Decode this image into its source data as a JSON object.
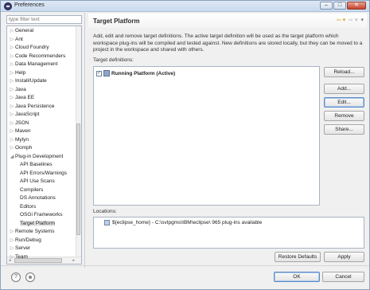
{
  "window": {
    "title": "Preferences",
    "controls": {
      "minimize": "–",
      "maximize": "□",
      "close": "✕"
    }
  },
  "sidebar": {
    "filter_placeholder": "type filter text",
    "items": [
      {
        "label": "General",
        "arrow": "▷",
        "indent": 0
      },
      {
        "label": "Ant",
        "arrow": "▷",
        "indent": 0
      },
      {
        "label": "Cloud Foundry",
        "arrow": "▷",
        "indent": 0
      },
      {
        "label": "Code Recommenders",
        "arrow": "▷",
        "indent": 0
      },
      {
        "label": "Data Management",
        "arrow": "▷",
        "indent": 0
      },
      {
        "label": "Help",
        "arrow": "▷",
        "indent": 0
      },
      {
        "label": "Install/Update",
        "arrow": "▷",
        "indent": 0
      },
      {
        "label": "Java",
        "arrow": "▷",
        "indent": 0
      },
      {
        "label": "Java EE",
        "arrow": "▷",
        "indent": 0
      },
      {
        "label": "Java Persistence",
        "arrow": "▷",
        "indent": 0
      },
      {
        "label": "JavaScript",
        "arrow": "▷",
        "indent": 0
      },
      {
        "label": "JSON",
        "arrow": "▷",
        "indent": 0
      },
      {
        "label": "Maven",
        "arrow": "▷",
        "indent": 0
      },
      {
        "label": "Mylyn",
        "arrow": "▷",
        "indent": 0
      },
      {
        "label": "Oomph",
        "arrow": "▷",
        "indent": 0
      },
      {
        "label": "Plug-in Development",
        "arrow": "◢",
        "indent": 0
      },
      {
        "label": "API Baselines",
        "arrow": "",
        "indent": 1
      },
      {
        "label": "API Errors/Warnings",
        "arrow": "",
        "indent": 1
      },
      {
        "label": "API Use Scans",
        "arrow": "",
        "indent": 1
      },
      {
        "label": "Compilers",
        "arrow": "",
        "indent": 1
      },
      {
        "label": "DS Annotations",
        "arrow": "",
        "indent": 1
      },
      {
        "label": "Editors",
        "arrow": "",
        "indent": 1
      },
      {
        "label": "OSGi Frameworks",
        "arrow": "",
        "indent": 1
      },
      {
        "label": "Target Platform",
        "arrow": "",
        "indent": 1,
        "selected": true
      },
      {
        "label": "Remote Systems",
        "arrow": "▷",
        "indent": 0
      },
      {
        "label": "Run/Debug",
        "arrow": "▷",
        "indent": 0
      },
      {
        "label": "Server",
        "arrow": "▷",
        "indent": 0
      },
      {
        "label": "Team",
        "arrow": "▷",
        "indent": 0
      }
    ],
    "hscroll": {
      "left": "◂",
      "thumb": "III",
      "right": "▸"
    }
  },
  "page": {
    "title": "Target Platform",
    "nav": {
      "back": "⇦ ▾",
      "forward": "⇨ ▾",
      "menu": "▾"
    },
    "description": "Add, edit and remove target definitions.  The active target definition will be used as the target platform which workspace plug-ins will be compiled and tested against.  New definitions are stored locally, but they can be moved to a project in the workspace and shared with others.",
    "targets_label": "Target definitions:",
    "targets": [
      {
        "checked": "✓",
        "name": "Running Platform (Active)"
      }
    ],
    "buttons": {
      "reload": "Reload...",
      "add": "Add...",
      "edit": "Edit...",
      "remove": "Remove",
      "share": "Share..."
    },
    "locations_label": "Locations:",
    "locations": [
      {
        "text": "${eclipse_home} - C:\\svtpgms\\IBM\\eclipse\\ 965 plug-ins available"
      }
    ],
    "restore_defaults": "Restore Defaults",
    "apply": "Apply"
  },
  "footer": {
    "help_icon": "?",
    "ok": "OK",
    "cancel": "Cancel"
  }
}
